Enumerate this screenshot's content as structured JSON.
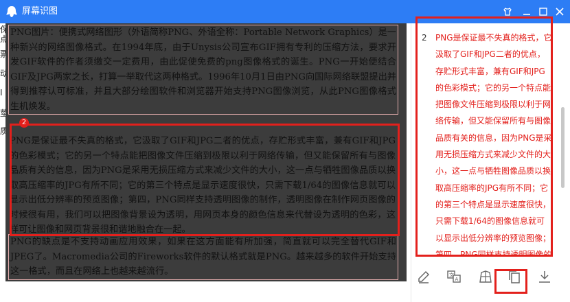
{
  "window": {
    "title": "屏幕识图",
    "accent": "#2d7df5",
    "highlight": "#e3201c"
  },
  "background_window": {
    "lines": [
      "保留所",
      "点与琢",
      "票",
      "动",
      "I",
      "莖",
      "质"
    ]
  },
  "document": {
    "paragraphs": [
      "PNG图片：便携式网络图形（外语简称PNG、外语全称：Portable Network Graphics）是一种新兴的网络图像格式。在1994年底，由于Unysis公司宣布GIF拥有专利的压缩方法，要求开发GIF软件的作者须缴交一定费用，由此促使免费的png图像格式的诞生。PNG一开始便结合GIF及JPG两家之长，打算一举取代这两种格式。1996年10月1日由PNG向国际网络联盟提出并得到推荐认可标准，并且大部分绘图软件和浏览器开始支持PNG图像浏览，从此PNG图像格式生机焕发。",
      "PNG是保证最不失真的格式，它汲取了GIF和JPG二者的优点，存贮形式丰富，兼有GIF和JPG的色彩模式；它的另一个特点能把图像文件压缩到极限以利于网络传输，但又能保留所有与图像品质有关的信息，因为PNG是采用无损压缩方式来减少文件的大小，这一点与牺牲图像品质以换取高压缩率的JPG有所不同；它的第三个特点是显示速度很快，只需下载1/64的图像信息就可以显示出低分辨率的预览图像；第四，PNG同样支持透明图像的制作，透明图像在制作网页图像的时候很有用，我们可以把图像背景设为透明，用网页本身的颜色信息来代替设为透明的色彩，这样可让图像和网页背景很和谐地融合在一起。",
      "PNG的缺点是不支持动画应用效果，如果在这方面能有所加强，简直就可以完全替代GIF和JPEG了。Macromedia公司的Fireworks软件的默认格式就是PNG。越来越多的软件开始支持这一格式，而且在网络上也越来越流行。"
    ],
    "selected_badge": "2"
  },
  "result": {
    "number": "2",
    "text": "PNG是保证最不失真的格式，它汲取了GIF和JPG二者的优点，存贮形式丰富，兼有GIF和JPG的色彩模式；它的另一个特点能把图像文件压缩到极限以利于网络传输，但又能保留所有与图像品质有关的信息，因为PNG是采用无损压缩方式来减少文件的大小，这一点与牺牲图像品质以换取高压缩率的JPG有所不同；它的第三个特点是显示速度很快，只需下载1/64的图像信息就可以显示出低分辨率的预览图像；第四，PNG同样支持透明图像的制"
  },
  "toolbar": {
    "icons": [
      "edit-icon",
      "translate-icon",
      "table-recognize-icon",
      "copy-icon",
      "download-icon"
    ]
  }
}
